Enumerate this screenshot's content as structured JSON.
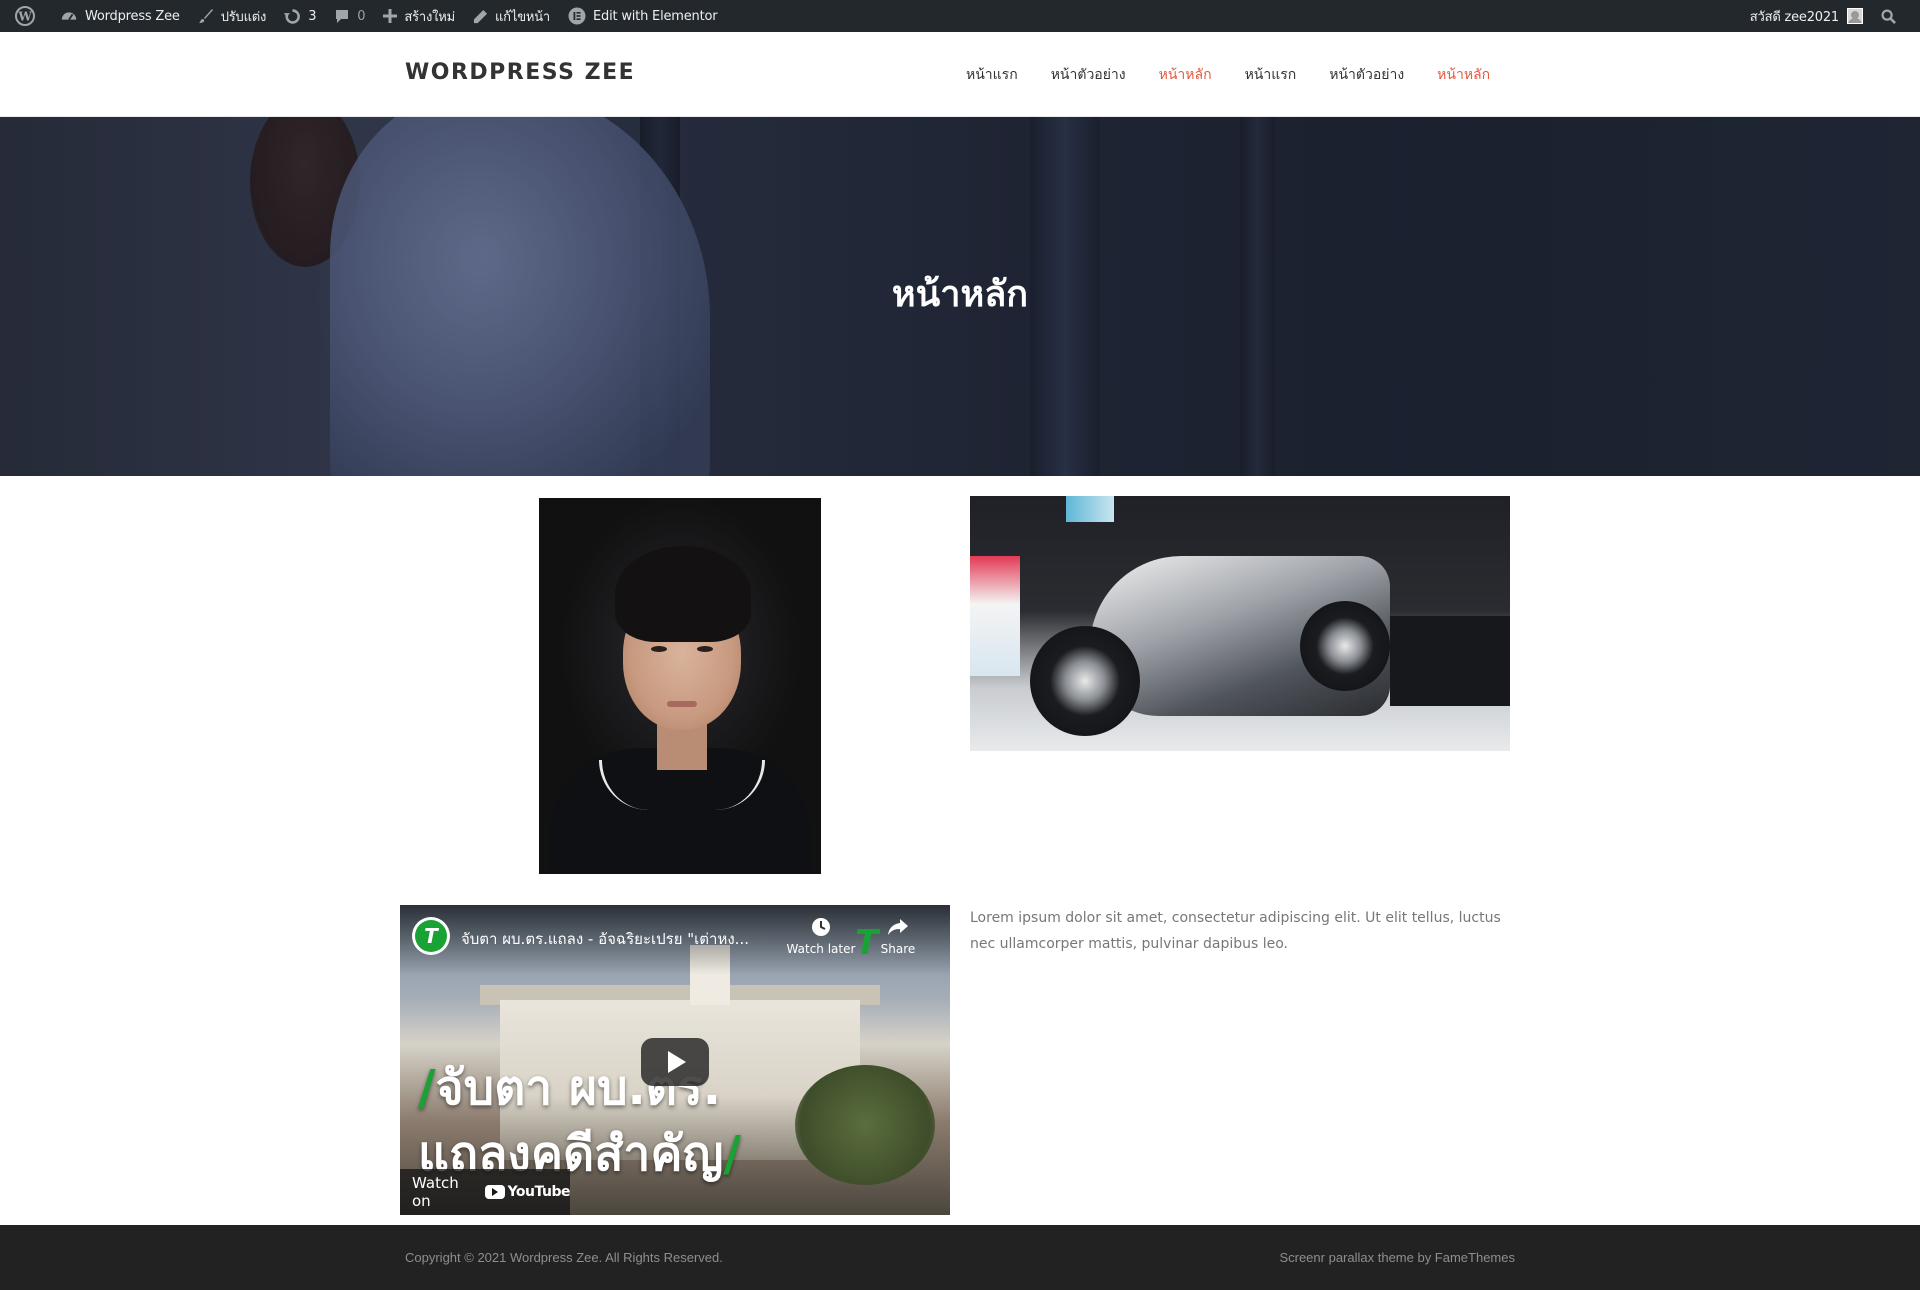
{
  "admin_bar": {
    "site_name": "Wordpress Zee",
    "customize": "ปรับแต่ง",
    "updates_count": "3",
    "comments_count": "0",
    "new": "สร้างใหม่",
    "edit_page": "แก้ไขหน้า",
    "elementor": "Edit with Elementor",
    "greeting": "สวัสดี zee2021"
  },
  "header": {
    "site_title": "WORDPRESS ZEE",
    "nav": [
      {
        "label": "หน้าแรก",
        "active": false
      },
      {
        "label": "หน้าตัวอย่าง",
        "active": false
      },
      {
        "label": "หน้าหลัก",
        "active": true
      },
      {
        "label": "หน้าแรก",
        "active": false
      },
      {
        "label": "หน้าตัวอย่าง",
        "active": false
      },
      {
        "label": "หน้าหลัก",
        "active": true
      }
    ]
  },
  "hero": {
    "title": "หน้าหลัก"
  },
  "video": {
    "channel_initial": "T",
    "title": "จับตา ผบ.ตร.แถลง - อัจฉริยะเปรย \"เต่าหง...",
    "watch_later": "Watch later",
    "share": "Share",
    "overlay_line1_slash": "/",
    "overlay_line1": "จับตา ผบ.ตร.",
    "overlay_line2": "แถลงคดีสำคัญ",
    "overlay_line2_slash": "/",
    "watch_on": "Watch on",
    "youtube": "YouTube"
  },
  "content": {
    "lorem": "Lorem ipsum dolor sit amet, consectetur adipiscing elit. Ut elit tellus, luctus nec ullamcorper mattis, pulvinar dapibus leo."
  },
  "footer": {
    "copyright": "Copyright © 2021 Wordpress Zee. All Rights Reserved.",
    "credit": "Screenr parallax theme by FameThemes"
  },
  "colors": {
    "admin_bar_bg": "#23282d",
    "accent": "#e4593f",
    "footer_bg": "#222222",
    "channel_green": "#1aa335"
  }
}
